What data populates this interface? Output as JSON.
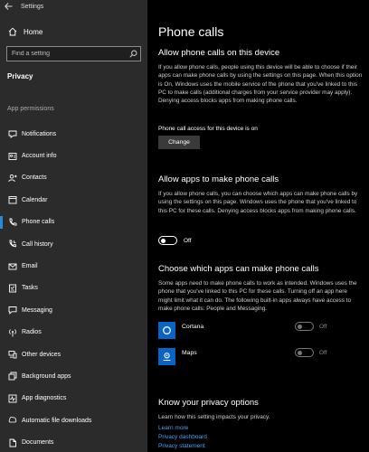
{
  "window": {
    "title": "Settings"
  },
  "sidebar": {
    "home_label": "Home",
    "search_placeholder": "Find a setting",
    "privacy_label": "Privacy",
    "section_label": "App permissions",
    "items": [
      {
        "label": "Notifications",
        "icon": "notifications-icon"
      },
      {
        "label": "Account info",
        "icon": "account-info-icon"
      },
      {
        "label": "Contacts",
        "icon": "contacts-icon"
      },
      {
        "label": "Calendar",
        "icon": "calendar-icon"
      },
      {
        "label": "Phone calls",
        "icon": "phone-icon",
        "active": true
      },
      {
        "label": "Call history",
        "icon": "call-history-icon"
      },
      {
        "label": "Email",
        "icon": "email-icon"
      },
      {
        "label": "Tasks",
        "icon": "tasks-icon"
      },
      {
        "label": "Messaging",
        "icon": "messaging-icon"
      },
      {
        "label": "Radios",
        "icon": "radios-icon"
      },
      {
        "label": "Other devices",
        "icon": "other-devices-icon"
      },
      {
        "label": "Background apps",
        "icon": "background-apps-icon"
      },
      {
        "label": "App diagnostics",
        "icon": "app-diagnostics-icon"
      },
      {
        "label": "Automatic file downloads",
        "icon": "file-downloads-icon"
      },
      {
        "label": "Documents",
        "icon": "documents-icon"
      }
    ]
  },
  "main": {
    "title": "Phone calls",
    "allow_device": {
      "heading": "Allow phone calls on this device",
      "body": "If you allow phone calls, people using this device will be able to choose if their apps can make phone calls by using the settings on this page. When this option is On, Windows uses the mobile service of the phone that you've linked to this PC to make calls (additional charges from your service provider may apply). Denying access blocks apps from making phone calls.",
      "status": "Phone call access for this device is on",
      "change_button": "Change"
    },
    "allow_apps": {
      "heading": "Allow apps to make phone calls",
      "body": "If you allow phone calls, you can choose which apps can make phone calls by using the settings on this page. Windows uses the phone that you've linked to this PC for these calls. Denying access blocks apps from making phone calls.",
      "toggle_label": "Off"
    },
    "choose_apps": {
      "heading": "Choose which apps can make phone calls",
      "body": "Some apps need to make phone calls to work as intended. Windows uses the phone that you've linked to this PC for these calls. Turning off an app here might limit what it can do. The following built-in apps always have access to make phone calls: People and Messaging.",
      "apps": [
        {
          "name": "Cortana",
          "icon": "cortana-icon",
          "state": "Off"
        },
        {
          "name": "Maps",
          "icon": "maps-icon",
          "state": "Off"
        }
      ]
    },
    "privacy": {
      "heading": "Know your privacy options",
      "body": "Learn how this setting impacts your privacy.",
      "links": [
        "Learn more",
        "Privacy dashboard",
        "Privacy statement"
      ]
    }
  },
  "colors": {
    "accent": "#2b8ad8",
    "link": "#4aa3ef",
    "app_tile": "#0a64c4",
    "sidebar_bg": "#2b2b2b"
  }
}
